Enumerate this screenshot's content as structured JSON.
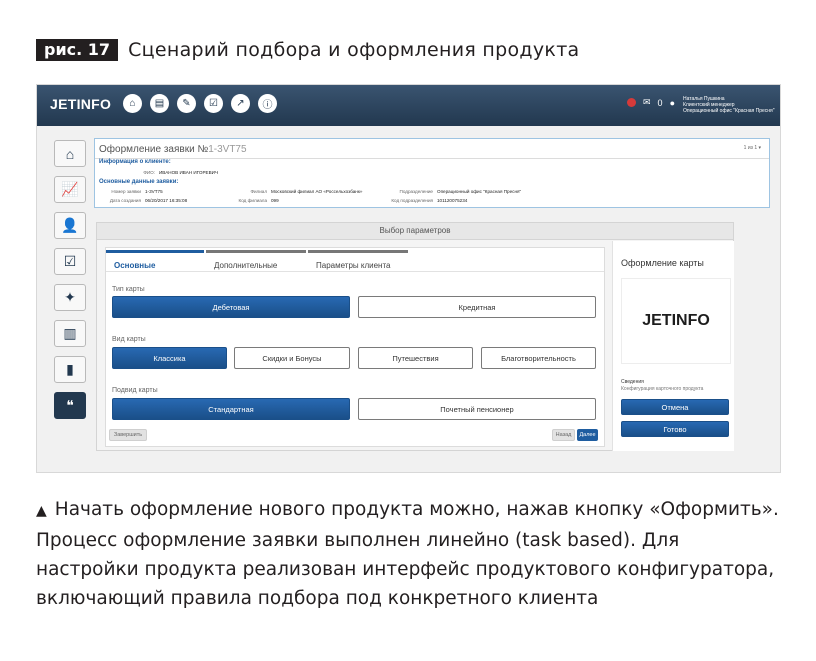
{
  "figure": {
    "badge": "рис. 17",
    "caption": "Сценарий подбора и оформления продукта"
  },
  "topbar": {
    "logo": "JETINFO",
    "nav_icons": [
      "home-icon",
      "document-icon",
      "wrench-icon",
      "checklist-icon",
      "chart-icon",
      "info-icon"
    ],
    "notification_count": "0",
    "user_name": "Наталья Пушкина",
    "user_role": "Клиентский менеджер",
    "user_office": "Операционный офис \"Красная Пресня\""
  },
  "sidebar": {
    "icons": [
      "home-icon",
      "analytics-icon",
      "user-icon",
      "clipboard-icon",
      "wrench-icon",
      "barcode-icon",
      "bar-chart-icon",
      "quote-icon"
    ],
    "active_index": 7
  },
  "application": {
    "title": "Оформление заявки №",
    "number": "1-3VT75",
    "pages": "1 из 1 ▾",
    "client_section": "Информация о клиенте:",
    "fio_label": "ФИО:",
    "fio_value": "ИВАНОВ ИВАН ИГОРЕВИЧ",
    "main_section": "Основные данные заявки:",
    "fields": {
      "req_no_label": "Номер заявки",
      "req_no_value": "1-3VT75",
      "created_label": "Дата создания",
      "created_value": "06/20/2017 16:35:08",
      "branch_label": "Филиал",
      "branch_value": "Московский филиал АО «Россельхозбанк»",
      "branch_code_label": "Код филиала",
      "branch_code_value": "099",
      "subdiv_label": "Подразделение",
      "subdiv_value": "Операционный офис \"Красная Пресня\"",
      "subdiv_code_label": "Код подразделения",
      "subdiv_code_value": "101120075234"
    }
  },
  "panel": {
    "title": "Выбор параметров",
    "tabs": [
      "Основные",
      "Дополнительные",
      "Параметры клиента"
    ],
    "card_type": {
      "label": "Тип карты",
      "options": [
        "Дебетовая",
        "Кредитная"
      ],
      "selected": "Дебетовая"
    },
    "card_kind": {
      "label": "Вид карты",
      "options": [
        "Классика",
        "Скидки и Бонусы",
        "Путешествия",
        "Благотворительность"
      ],
      "selected": "Классика"
    },
    "card_subkind": {
      "label": "Подвид карты",
      "options": [
        "Стандартная",
        "Почетный пенсионер"
      ],
      "selected": "Стандартная"
    },
    "finish_label": "Завершить",
    "back_label": "Назад",
    "next_label": "Далее"
  },
  "card_side": {
    "title": "Оформление карты",
    "logo_text": "JETINFO",
    "info_label": "Сведения",
    "info_sub": "Конфигурация карточного продукта",
    "cancel_label": "Отмена",
    "done_label": "Готово"
  },
  "footnote": {
    "text": "Начать оформление нового продукта можно, нажав кнопку «Оформить». Процесс оформление заявки выполнен линейно (task based). Для настройки продукта реализован интерфейс продуктового конфигуратора, включающий правила подбора под конкретного клиента"
  }
}
